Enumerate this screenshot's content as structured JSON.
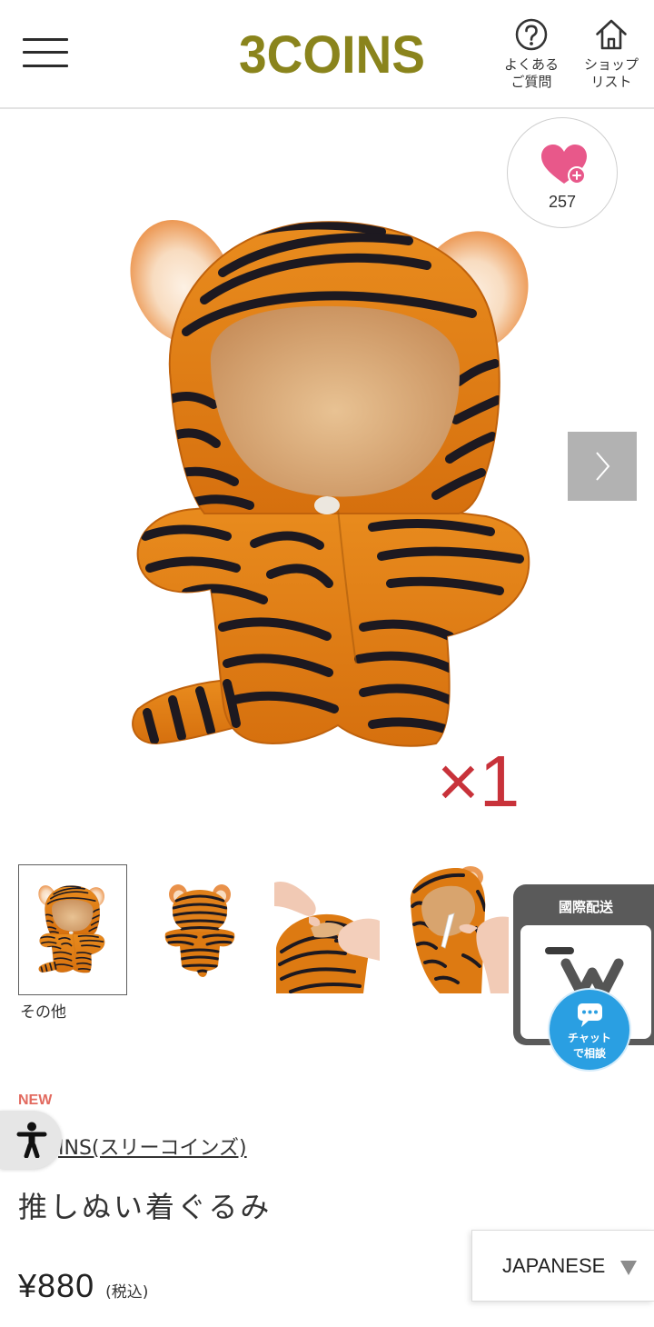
{
  "header": {
    "menu_icon": "hamburger-menu-icon",
    "logo": "3COINS",
    "faq": {
      "icon": "question-circle-icon",
      "line1": "よくある",
      "line2": "ご質問"
    },
    "shop": {
      "icon": "house-icon",
      "line1": "ショップ",
      "line2": "リスト"
    }
  },
  "favorite": {
    "icon": "heart-plus-icon",
    "count": "257"
  },
  "gallery": {
    "image_overlay": "×1",
    "next_icon": "chevron-right-icon",
    "thumbnail_caption": "その他"
  },
  "intl_shipping": {
    "label": "國際配送",
    "logo_icon": "w-logo-icon"
  },
  "chat": {
    "icon": "chat-bubble-icon",
    "line1": "チャット",
    "line2": "で相談"
  },
  "accessibility": {
    "icon": "accessibility-person-icon"
  },
  "product": {
    "badge": "NEW",
    "brand": "INS(スリーコインズ)",
    "title": "推しぬい着ぐるみ",
    "price": "¥880",
    "tax_note": "(税込)"
  },
  "language": {
    "selected": "JAPANESE",
    "icon": "triangle-down-icon"
  },
  "colors": {
    "logo": "#8a841c",
    "heart": "#e8588a",
    "chat": "#2a9fe2",
    "badge": "#e26a5f",
    "overlay_text": "#c8323a"
  }
}
